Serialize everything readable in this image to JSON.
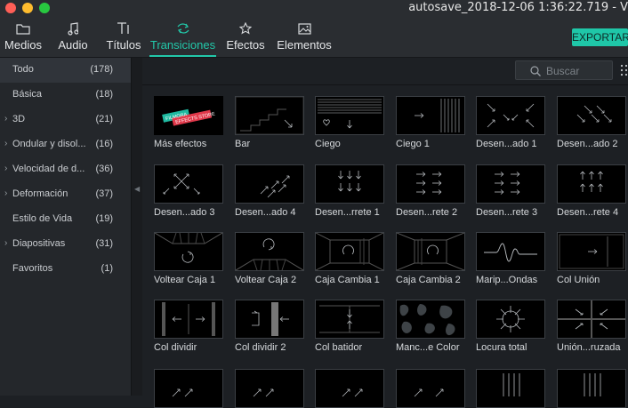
{
  "window": {
    "title": "autosave_2018-12-06 1:36:22.719 - V"
  },
  "nav": {
    "tabs": [
      {
        "label": "Medios",
        "icon": "folder-icon"
      },
      {
        "label": "Audio",
        "icon": "music-note-icon"
      },
      {
        "label": "Títulos",
        "icon": "text-icon"
      },
      {
        "label": "Transiciones",
        "icon": "transition-icon",
        "active": true
      },
      {
        "label": "Efectos",
        "icon": "effects-icon"
      },
      {
        "label": "Elementos",
        "icon": "image-icon"
      }
    ],
    "export_label": "EXPORTAR"
  },
  "sidebar": {
    "items": [
      {
        "label": "Todo",
        "count": "(178)",
        "expandable": false,
        "selected": true
      },
      {
        "label": "Básica",
        "count": "(18)",
        "expandable": false
      },
      {
        "label": "3D",
        "count": "(21)",
        "expandable": true
      },
      {
        "label": "Ondular y disol...",
        "count": "(16)",
        "expandable": true
      },
      {
        "label": "Velocidad de d...",
        "count": "(36)",
        "expandable": true
      },
      {
        "label": "Deformación",
        "count": "(37)",
        "expandable": true
      },
      {
        "label": "Estilo de Vida",
        "count": "(19)",
        "expandable": false
      },
      {
        "label": "Diapositivas",
        "count": "(31)",
        "expandable": true
      },
      {
        "label": "Favoritos",
        "count": "(1)",
        "expandable": false
      }
    ]
  },
  "search": {
    "placeholder": "Buscar"
  },
  "tiles": [
    {
      "label": "Más efectos",
      "preview": "filmora-effects-store"
    },
    {
      "label": "Bar"
    },
    {
      "label": "Ciego"
    },
    {
      "label": "Ciego 1"
    },
    {
      "label": "Desen...ado 1"
    },
    {
      "label": "Desen...ado 2"
    },
    {
      "label": "Desen...ado 3"
    },
    {
      "label": "Desen...ado 4"
    },
    {
      "label": "Desen...rrete 1"
    },
    {
      "label": "Desen...rete 2"
    },
    {
      "label": "Desen...rete 3"
    },
    {
      "label": "Desen...rete 4"
    },
    {
      "label": "Voltear Caja 1"
    },
    {
      "label": "Voltear Caja 2"
    },
    {
      "label": "Caja Cambia 1"
    },
    {
      "label": "Caja Cambia 2"
    },
    {
      "label": "Marip...Ondas"
    },
    {
      "label": "Col Unión"
    },
    {
      "label": "Col dividir"
    },
    {
      "label": "Col dividir 2"
    },
    {
      "label": "Col batidor"
    },
    {
      "label": "Manc...e Color"
    },
    {
      "label": "Locura total"
    },
    {
      "label": "Unión...ruzada"
    },
    {
      "label": ""
    },
    {
      "label": ""
    },
    {
      "label": ""
    },
    {
      "label": ""
    },
    {
      "label": ""
    },
    {
      "label": ""
    }
  ],
  "store_badge": {
    "line1": "FILMORA",
    "line2": "EFFECTS STORE"
  },
  "colors": {
    "accent": "#22c8a9",
    "tile_line": "#b8bcc0"
  }
}
